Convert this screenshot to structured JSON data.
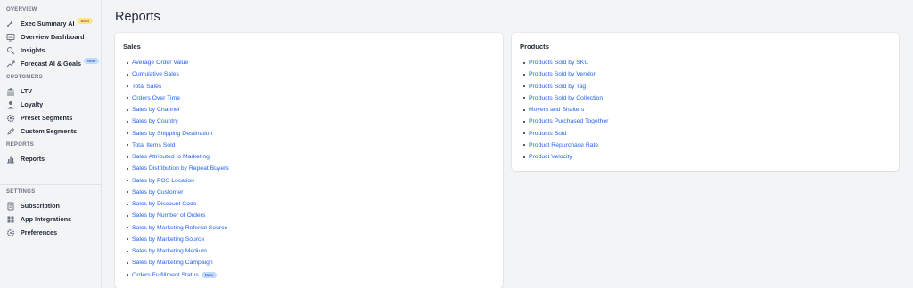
{
  "sidebar": {
    "sections": {
      "overview": "OVERVIEW",
      "customers": "CUSTOMERS",
      "reports": "REPORTS",
      "settings": "SETTINGS"
    },
    "items": {
      "exec_summary": {
        "label": "Exec Summary AI",
        "badge": "Beta",
        "icon": "sparkle-icon"
      },
      "overview_dashboard": {
        "label": "Overview Dashboard",
        "icon": "dashboard-icon"
      },
      "insights": {
        "label": "Insights",
        "icon": "insights-icon"
      },
      "forecast": {
        "label": "Forecast AI & Goals",
        "badge": "New",
        "icon": "forecast-icon"
      },
      "ltv": {
        "label": "LTV",
        "icon": "bank-icon"
      },
      "loyalty": {
        "label": "Loyalty",
        "icon": "person-icon"
      },
      "preset_segments": {
        "label": "Preset Segments",
        "icon": "gear-icon"
      },
      "custom_segments": {
        "label": "Custom Segments",
        "icon": "pencil-icon"
      },
      "reports": {
        "label": "Reports",
        "icon": "bar-chart-icon"
      },
      "subscription": {
        "label": "Subscription",
        "icon": "document-icon"
      },
      "app_integrations": {
        "label": "App Integrations",
        "icon": "grid-icon"
      },
      "preferences": {
        "label": "Preferences",
        "icon": "settings-icon"
      }
    }
  },
  "main": {
    "title": "Reports",
    "sales": {
      "title": "Sales",
      "links": [
        "Average Order Value",
        "Cumulative Sales",
        "Total Sales",
        "Orders Over Time",
        "Sales by Channel",
        "Sales by Country",
        "Sales by Shipping Destination",
        "Total Items Sold",
        "Sales Attributed to Marketing",
        "Sales Distribution by Repeat Buyers",
        "Sales by POS Location",
        "Sales by Customer",
        "Sales by Discount Code",
        "Sales by Number of Orders",
        "Sales by Marketing Referral Source",
        "Sales by Marketing Source",
        "Sales by Marketing Medium",
        "Sales by Marketing Campaign",
        "Orders Fulfillment Status"
      ],
      "last_badge": "New"
    },
    "products": {
      "title": "Products",
      "links": [
        "Products Sold by SKU",
        "Products Sold by Vendor",
        "Products Sold by Tag",
        "Products Sold by Collection",
        "Movers and Shakers",
        "Products Purchased Together",
        "Products Sold",
        "Product Repurchase Rate",
        "Product Velocity"
      ]
    }
  },
  "colors": {
    "link": "#2563eb",
    "beta_badge": "#fde68a",
    "new_badge": "#bfdbfe",
    "background": "#f3f4f6"
  }
}
